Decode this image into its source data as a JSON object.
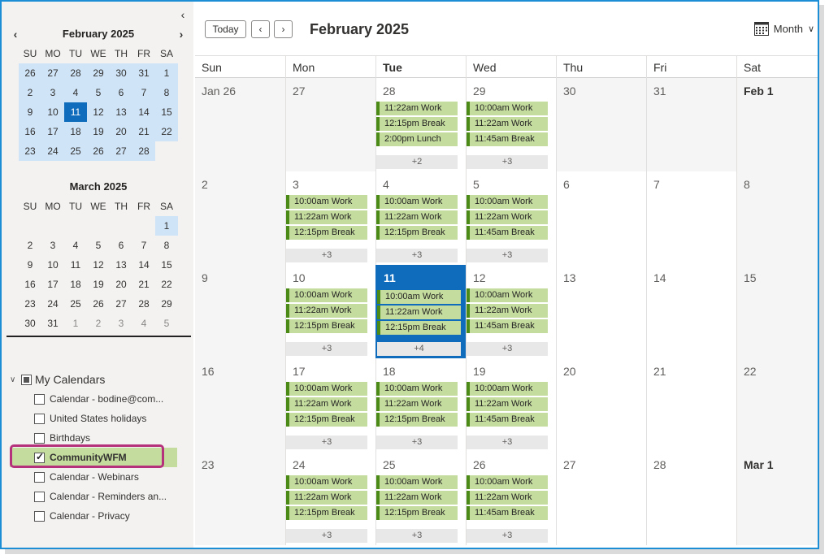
{
  "mini_calendars": [
    {
      "title": "February 2025",
      "dow": [
        "SU",
        "MO",
        "TU",
        "WE",
        "TH",
        "FR",
        "SA"
      ],
      "weeks": [
        [
          "26",
          "27",
          "28",
          "29",
          "30",
          "31",
          "1"
        ],
        [
          "2",
          "3",
          "4",
          "5",
          "6",
          "7",
          "8"
        ],
        [
          "9",
          "10",
          "11",
          "12",
          "13",
          "14",
          "15"
        ],
        [
          "16",
          "17",
          "18",
          "19",
          "20",
          "21",
          "22"
        ],
        [
          "23",
          "24",
          "25",
          "26",
          "27",
          "28",
          ""
        ]
      ]
    },
    {
      "title": "March 2025",
      "dow": [
        "SU",
        "MO",
        "TU",
        "WE",
        "TH",
        "FR",
        "SA"
      ],
      "weeks": [
        [
          "",
          "",
          "",
          "",
          "",
          "",
          "1"
        ],
        [
          "2",
          "3",
          "4",
          "5",
          "6",
          "7",
          "8"
        ],
        [
          "9",
          "10",
          "11",
          "12",
          "13",
          "14",
          "15"
        ],
        [
          "16",
          "17",
          "18",
          "19",
          "20",
          "21",
          "22"
        ],
        [
          "23",
          "24",
          "25",
          "26",
          "27",
          "28",
          "29"
        ],
        [
          "30",
          "31",
          "1",
          "2",
          "3",
          "4",
          "5"
        ]
      ]
    }
  ],
  "my_calendars": {
    "heading": "My Calendars",
    "items": [
      {
        "label": "Calendar - bodine@com...",
        "checked": false
      },
      {
        "label": "United States holidays",
        "checked": false
      },
      {
        "label": "Birthdays",
        "checked": false
      },
      {
        "label": "CommunityWFM",
        "checked": true
      },
      {
        "label": "Calendar - Webinars",
        "checked": false
      },
      {
        "label": "Calendar - Reminders an...",
        "checked": false
      },
      {
        "label": "Calendar - Privacy",
        "checked": false
      }
    ]
  },
  "toolbar": {
    "today_label": "Today",
    "prev_icon": "chevron-left-icon",
    "next_icon": "chevron-right-icon",
    "title": "February 2025",
    "view_label": "Month",
    "view_icon": "calendar-grid-icon"
  },
  "month_view": {
    "dow": [
      "Sun",
      "Mon",
      "Tue",
      "Wed",
      "Thu",
      "Fri",
      "Sat"
    ],
    "current_dow_index": 2,
    "weeks": [
      [
        {
          "num": "Jan 26",
          "out": true
        },
        {
          "num": "27",
          "out": true
        },
        {
          "num": "28",
          "out": true,
          "events": [
            "11:22am Work",
            "12:15pm Break",
            "2:00pm Lunch"
          ],
          "more": "+2"
        },
        {
          "num": "29",
          "out": true,
          "events": [
            "10:00am Work",
            "11:22am Work",
            "11:45am Break"
          ],
          "more": "+3"
        },
        {
          "num": "30",
          "out": true
        },
        {
          "num": "31",
          "out": true
        },
        {
          "num": "Feb 1",
          "bold": true
        }
      ],
      [
        {
          "num": "2"
        },
        {
          "num": "3",
          "events": [
            "10:00am Work",
            "11:22am Work",
            "12:15pm Break"
          ],
          "more": "+3"
        },
        {
          "num": "4",
          "events": [
            "10:00am Work",
            "11:22am Work",
            "12:15pm Break"
          ],
          "more": "+3"
        },
        {
          "num": "5",
          "events": [
            "10:00am Work",
            "11:22am Work",
            "11:45am Break"
          ],
          "more": "+3"
        },
        {
          "num": "6"
        },
        {
          "num": "7"
        },
        {
          "num": "8"
        }
      ],
      [
        {
          "num": "9"
        },
        {
          "num": "10",
          "events": [
            "10:00am Work",
            "11:22am Work",
            "12:15pm Break"
          ],
          "more": "+3"
        },
        {
          "num": "11",
          "today": true,
          "events": [
            "10:00am Work",
            "11:22am Work",
            "12:15pm Break"
          ],
          "more": "+4"
        },
        {
          "num": "12",
          "events": [
            "10:00am Work",
            "11:22am Work",
            "11:45am Break"
          ],
          "more": "+3"
        },
        {
          "num": "13"
        },
        {
          "num": "14"
        },
        {
          "num": "15"
        }
      ],
      [
        {
          "num": "16"
        },
        {
          "num": "17",
          "events": [
            "10:00am Work",
            "11:22am Work",
            "12:15pm Break"
          ],
          "more": "+3"
        },
        {
          "num": "18",
          "events": [
            "10:00am Work",
            "11:22am Work",
            "12:15pm Break"
          ],
          "more": "+3"
        },
        {
          "num": "19",
          "events": [
            "10:00am Work",
            "11:22am Work",
            "11:45am Break"
          ],
          "more": "+3"
        },
        {
          "num": "20"
        },
        {
          "num": "21"
        },
        {
          "num": "22"
        }
      ],
      [
        {
          "num": "23"
        },
        {
          "num": "24",
          "events": [
            "10:00am Work",
            "11:22am Work",
            "12:15pm Break"
          ],
          "more": "+3"
        },
        {
          "num": "25",
          "events": [
            "10:00am Work",
            "11:22am Work",
            "12:15pm Break"
          ],
          "more": "+3"
        },
        {
          "num": "26",
          "events": [
            "10:00am Work",
            "11:22am Work",
            "11:45am Break"
          ],
          "more": "+3"
        },
        {
          "num": "27"
        },
        {
          "num": "28"
        },
        {
          "num": "Mar 1",
          "bold": true
        }
      ]
    ]
  },
  "colors": {
    "accent": "#0f6cbd",
    "event_bg": "#c4dc9e",
    "event_bar": "#4b8a17",
    "selected_highlight_border": "#b5317b"
  }
}
